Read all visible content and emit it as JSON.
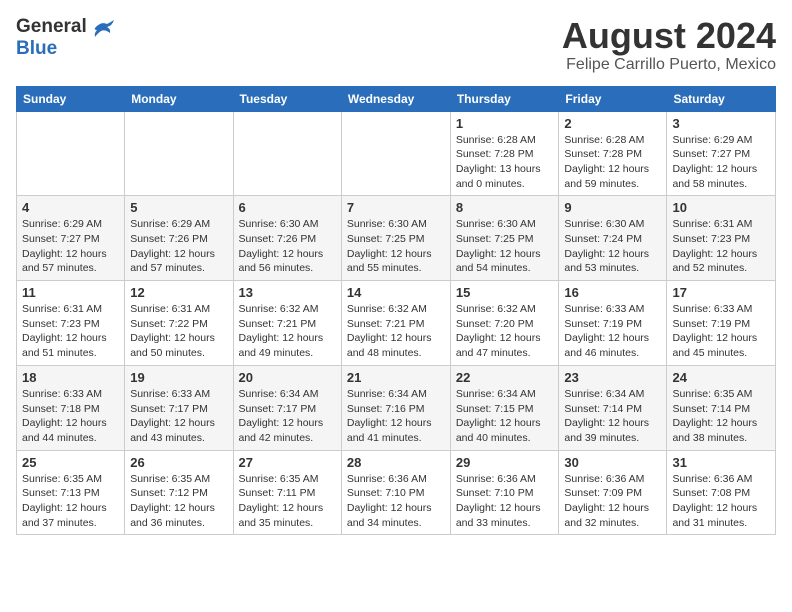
{
  "header": {
    "logo_general": "General",
    "logo_blue": "Blue",
    "title": "August 2024",
    "subtitle": "Felipe Carrillo Puerto, Mexico"
  },
  "calendar": {
    "headers": [
      "Sunday",
      "Monday",
      "Tuesday",
      "Wednesday",
      "Thursday",
      "Friday",
      "Saturday"
    ],
    "weeks": [
      [
        {
          "day": "",
          "info": ""
        },
        {
          "day": "",
          "info": ""
        },
        {
          "day": "",
          "info": ""
        },
        {
          "day": "",
          "info": ""
        },
        {
          "day": "1",
          "sunrise": "Sunrise: 6:28 AM",
          "sunset": "Sunset: 7:28 PM",
          "daylight": "Daylight: 13 hours and 0 minutes."
        },
        {
          "day": "2",
          "sunrise": "Sunrise: 6:28 AM",
          "sunset": "Sunset: 7:28 PM",
          "daylight": "Daylight: 12 hours and 59 minutes."
        },
        {
          "day": "3",
          "sunrise": "Sunrise: 6:29 AM",
          "sunset": "Sunset: 7:27 PM",
          "daylight": "Daylight: 12 hours and 58 minutes."
        }
      ],
      [
        {
          "day": "4",
          "sunrise": "Sunrise: 6:29 AM",
          "sunset": "Sunset: 7:27 PM",
          "daylight": "Daylight: 12 hours and 57 minutes."
        },
        {
          "day": "5",
          "sunrise": "Sunrise: 6:29 AM",
          "sunset": "Sunset: 7:26 PM",
          "daylight": "Daylight: 12 hours and 57 minutes."
        },
        {
          "day": "6",
          "sunrise": "Sunrise: 6:30 AM",
          "sunset": "Sunset: 7:26 PM",
          "daylight": "Daylight: 12 hours and 56 minutes."
        },
        {
          "day": "7",
          "sunrise": "Sunrise: 6:30 AM",
          "sunset": "Sunset: 7:25 PM",
          "daylight": "Daylight: 12 hours and 55 minutes."
        },
        {
          "day": "8",
          "sunrise": "Sunrise: 6:30 AM",
          "sunset": "Sunset: 7:25 PM",
          "daylight": "Daylight: 12 hours and 54 minutes."
        },
        {
          "day": "9",
          "sunrise": "Sunrise: 6:30 AM",
          "sunset": "Sunset: 7:24 PM",
          "daylight": "Daylight: 12 hours and 53 minutes."
        },
        {
          "day": "10",
          "sunrise": "Sunrise: 6:31 AM",
          "sunset": "Sunset: 7:23 PM",
          "daylight": "Daylight: 12 hours and 52 minutes."
        }
      ],
      [
        {
          "day": "11",
          "sunrise": "Sunrise: 6:31 AM",
          "sunset": "Sunset: 7:23 PM",
          "daylight": "Daylight: 12 hours and 51 minutes."
        },
        {
          "day": "12",
          "sunrise": "Sunrise: 6:31 AM",
          "sunset": "Sunset: 7:22 PM",
          "daylight": "Daylight: 12 hours and 50 minutes."
        },
        {
          "day": "13",
          "sunrise": "Sunrise: 6:32 AM",
          "sunset": "Sunset: 7:21 PM",
          "daylight": "Daylight: 12 hours and 49 minutes."
        },
        {
          "day": "14",
          "sunrise": "Sunrise: 6:32 AM",
          "sunset": "Sunset: 7:21 PM",
          "daylight": "Daylight: 12 hours and 48 minutes."
        },
        {
          "day": "15",
          "sunrise": "Sunrise: 6:32 AM",
          "sunset": "Sunset: 7:20 PM",
          "daylight": "Daylight: 12 hours and 47 minutes."
        },
        {
          "day": "16",
          "sunrise": "Sunrise: 6:33 AM",
          "sunset": "Sunset: 7:19 PM",
          "daylight": "Daylight: 12 hours and 46 minutes."
        },
        {
          "day": "17",
          "sunrise": "Sunrise: 6:33 AM",
          "sunset": "Sunset: 7:19 PM",
          "daylight": "Daylight: 12 hours and 45 minutes."
        }
      ],
      [
        {
          "day": "18",
          "sunrise": "Sunrise: 6:33 AM",
          "sunset": "Sunset: 7:18 PM",
          "daylight": "Daylight: 12 hours and 44 minutes."
        },
        {
          "day": "19",
          "sunrise": "Sunrise: 6:33 AM",
          "sunset": "Sunset: 7:17 PM",
          "daylight": "Daylight: 12 hours and 43 minutes."
        },
        {
          "day": "20",
          "sunrise": "Sunrise: 6:34 AM",
          "sunset": "Sunset: 7:17 PM",
          "daylight": "Daylight: 12 hours and 42 minutes."
        },
        {
          "day": "21",
          "sunrise": "Sunrise: 6:34 AM",
          "sunset": "Sunset: 7:16 PM",
          "daylight": "Daylight: 12 hours and 41 minutes."
        },
        {
          "day": "22",
          "sunrise": "Sunrise: 6:34 AM",
          "sunset": "Sunset: 7:15 PM",
          "daylight": "Daylight: 12 hours and 40 minutes."
        },
        {
          "day": "23",
          "sunrise": "Sunrise: 6:34 AM",
          "sunset": "Sunset: 7:14 PM",
          "daylight": "Daylight: 12 hours and 39 minutes."
        },
        {
          "day": "24",
          "sunrise": "Sunrise: 6:35 AM",
          "sunset": "Sunset: 7:14 PM",
          "daylight": "Daylight: 12 hours and 38 minutes."
        }
      ],
      [
        {
          "day": "25",
          "sunrise": "Sunrise: 6:35 AM",
          "sunset": "Sunset: 7:13 PM",
          "daylight": "Daylight: 12 hours and 37 minutes."
        },
        {
          "day": "26",
          "sunrise": "Sunrise: 6:35 AM",
          "sunset": "Sunset: 7:12 PM",
          "daylight": "Daylight: 12 hours and 36 minutes."
        },
        {
          "day": "27",
          "sunrise": "Sunrise: 6:35 AM",
          "sunset": "Sunset: 7:11 PM",
          "daylight": "Daylight: 12 hours and 35 minutes."
        },
        {
          "day": "28",
          "sunrise": "Sunrise: 6:36 AM",
          "sunset": "Sunset: 7:10 PM",
          "daylight": "Daylight: 12 hours and 34 minutes."
        },
        {
          "day": "29",
          "sunrise": "Sunrise: 6:36 AM",
          "sunset": "Sunset: 7:10 PM",
          "daylight": "Daylight: 12 hours and 33 minutes."
        },
        {
          "day": "30",
          "sunrise": "Sunrise: 6:36 AM",
          "sunset": "Sunset: 7:09 PM",
          "daylight": "Daylight: 12 hours and 32 minutes."
        },
        {
          "day": "31",
          "sunrise": "Sunrise: 6:36 AM",
          "sunset": "Sunset: 7:08 PM",
          "daylight": "Daylight: 12 hours and 31 minutes."
        }
      ]
    ]
  }
}
